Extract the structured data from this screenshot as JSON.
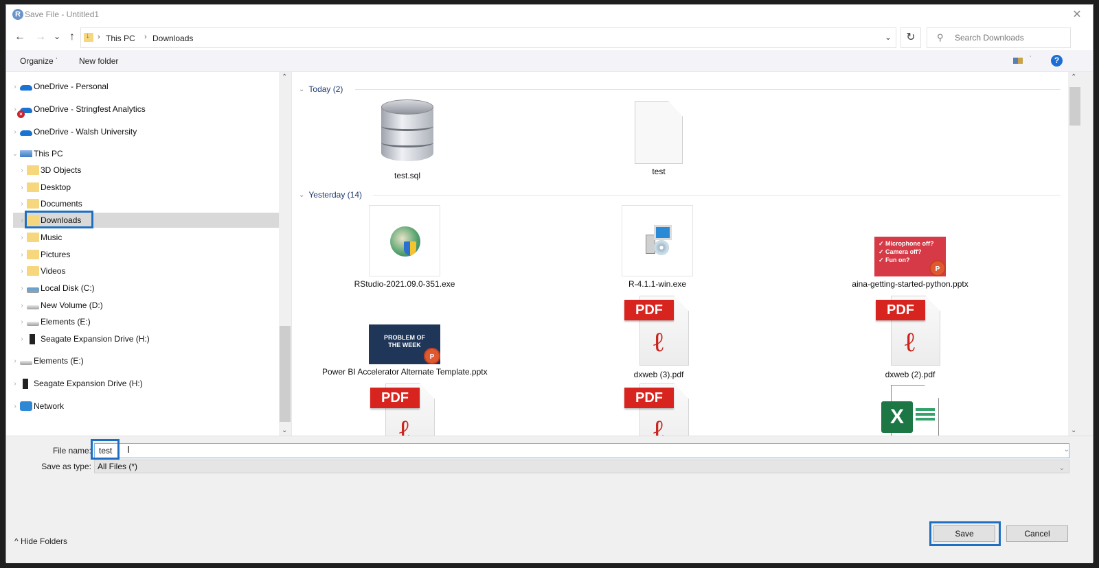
{
  "window": {
    "title": "Save File - Untitled1",
    "app_icon_letter": "R",
    "close_glyph": "✕"
  },
  "navigation": {
    "back_glyph": "←",
    "forward_glyph": "→",
    "recent_glyph": "⌄",
    "up_glyph": "↑",
    "breadcrumb": [
      "This PC",
      "Downloads"
    ],
    "breadcrumb_sep": "›",
    "dropdown_glyph": "⌄",
    "refresh_glyph": "↻",
    "search_placeholder": "Search Downloads",
    "search_glyph": "⚲"
  },
  "toolbar": {
    "organize_label": "Organize ˙",
    "new_folder_label": "New folder",
    "view_dropdown_glyph": "˙",
    "help_glyph": "?"
  },
  "sidebar": {
    "items": [
      {
        "label": "OneDrive - Personal",
        "icon": "onedrive-icon"
      },
      {
        "label": "OneDrive - Stringfest Analytics",
        "icon": "onedrive-error-icon"
      },
      {
        "label": "OneDrive - Walsh University",
        "icon": "onedrive-icon"
      },
      {
        "label": "This PC",
        "icon": "this-pc-icon",
        "expanded": true
      },
      {
        "label": "3D Objects",
        "icon": "folder-3d-objects-icon"
      },
      {
        "label": "Desktop",
        "icon": "folder-desktop-icon"
      },
      {
        "label": "Documents",
        "icon": "folder-documents-icon"
      },
      {
        "label": "Downloads",
        "icon": "folder-downloads-icon",
        "selected": true
      },
      {
        "label": "Music",
        "icon": "folder-music-icon"
      },
      {
        "label": "Pictures",
        "icon": "folder-pictures-icon"
      },
      {
        "label": "Videos",
        "icon": "folder-videos-icon"
      },
      {
        "label": "Local Disk (C:)",
        "icon": "local-disk-icon"
      },
      {
        "label": "New Volume (D:)",
        "icon": "drive-icon"
      },
      {
        "label": "Elements (E:)",
        "icon": "drive-icon"
      },
      {
        "label": "Seagate Expansion Drive (H:)",
        "icon": "external-drive-icon"
      },
      {
        "label": "Elements (E:)",
        "icon": "drive-icon"
      },
      {
        "label": "Seagate Expansion Drive (H:)",
        "icon": "external-drive-icon"
      },
      {
        "label": "Network",
        "icon": "network-icon"
      }
    ],
    "collapsed_chevron": "›",
    "expanded_chevron": "⌄",
    "error_badge_glyph": "×"
  },
  "content": {
    "groups": [
      {
        "label": "Today (2)",
        "files": [
          {
            "name": "test.sql",
            "type": "sql"
          },
          {
            "name": "test",
            "type": "blank"
          }
        ]
      },
      {
        "label": "Yesterday (14)",
        "files": [
          {
            "name": "RStudio-2021.09.0-351.exe",
            "type": "exe-rstudio"
          },
          {
            "name": "R-4.1.1-win.exe",
            "type": "exe-setup"
          },
          {
            "name": "aina-getting-started-python.pptx",
            "type": "pptx",
            "thumb_lines": [
              "✓ Microphone off?",
              "✓ Camera off?",
              "✓ Fun on?"
            ]
          },
          {
            "name": "Power BI Accelerator Alternate Template.pptx",
            "type": "pptx",
            "thumb_lines": [
              "PROBLEM OF",
              "THE WEEK"
            ]
          },
          {
            "name": "dxweb (3).pdf",
            "type": "pdf"
          },
          {
            "name": "dxweb (2).pdf",
            "type": "pdf"
          },
          {
            "name": "",
            "type": "pdf"
          },
          {
            "name": "",
            "type": "pdf"
          },
          {
            "name": "",
            "type": "xlsx"
          }
        ]
      }
    ],
    "group_chevron": "⌄",
    "pdf_label": "PDF",
    "pdf_logo_glyph": "ℓ",
    "ppt_badge": "P",
    "xls_badge": "X"
  },
  "form": {
    "file_name_label": "File name:",
    "file_name_value": "test",
    "save_as_type_label": "Save as type:",
    "save_as_type_value": "All Files  (*)",
    "dropdown_glyph": "⌄",
    "ibeam_glyph": "I"
  },
  "footer": {
    "hide_folders_label": "Hide Folders",
    "hide_folders_glyph": "^",
    "save_label": "Save",
    "cancel_label": "Cancel"
  },
  "colors": {
    "highlight": "#1e6fc2",
    "selected_row": "#d9d9d9",
    "pdf_red": "#d8241e",
    "excel_green": "#1d7745",
    "help_blue": "#1a6ed6"
  }
}
